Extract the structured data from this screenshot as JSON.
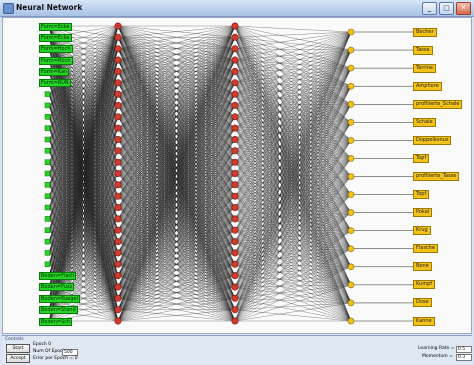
{
  "window": {
    "title": "Neural Network",
    "buttons": {
      "minimize": "_",
      "maximize": "□",
      "close": "✕"
    }
  },
  "network": {
    "input_labels_top": [
      "Form=Ecke",
      "Form=Ecke",
      "Form=Hoch",
      "Form=Hoch",
      "Form=Kan",
      "Form=RUN"
    ],
    "input_labels_bottom": [
      "Boden=Flach",
      "Boden=Fuss",
      "Boden=Kuegel",
      "Boden=Stand",
      "Boden=Sch"
    ],
    "input_unlabeled_count": 27,
    "hidden1_count": 27,
    "hidden2_count": 27,
    "output_labels": [
      "Becher",
      "Tasse",
      "Terrine",
      "Amphore",
      "profilierte_Schale",
      "Schale",
      "Doppelkonus",
      "Topf",
      "profilierte_Tasse",
      "Topf",
      "Pokal",
      "Krug",
      "Flasche",
      "Bene",
      "Kumpf",
      "Dose",
      "Kanne"
    ],
    "colors": {
      "input": "#26d226",
      "hidden": "#d23a2e",
      "output": "#f3c21a",
      "links": "#1a1a1a"
    }
  },
  "controls": {
    "title": "Controls",
    "start_label": "Start",
    "accept_label": "Accept",
    "epoch_label": "Epoch",
    "epoch_value": "0",
    "num_epochs_label": "Num Of Epochs",
    "num_epochs_value": "500",
    "error_label": "Error per Epoch =",
    "error_value": "0",
    "learning_rate_label": "Learning Rate =",
    "learning_rate_value": "0.5",
    "momentum_label": "Momentum =",
    "momentum_value": "0.3"
  }
}
